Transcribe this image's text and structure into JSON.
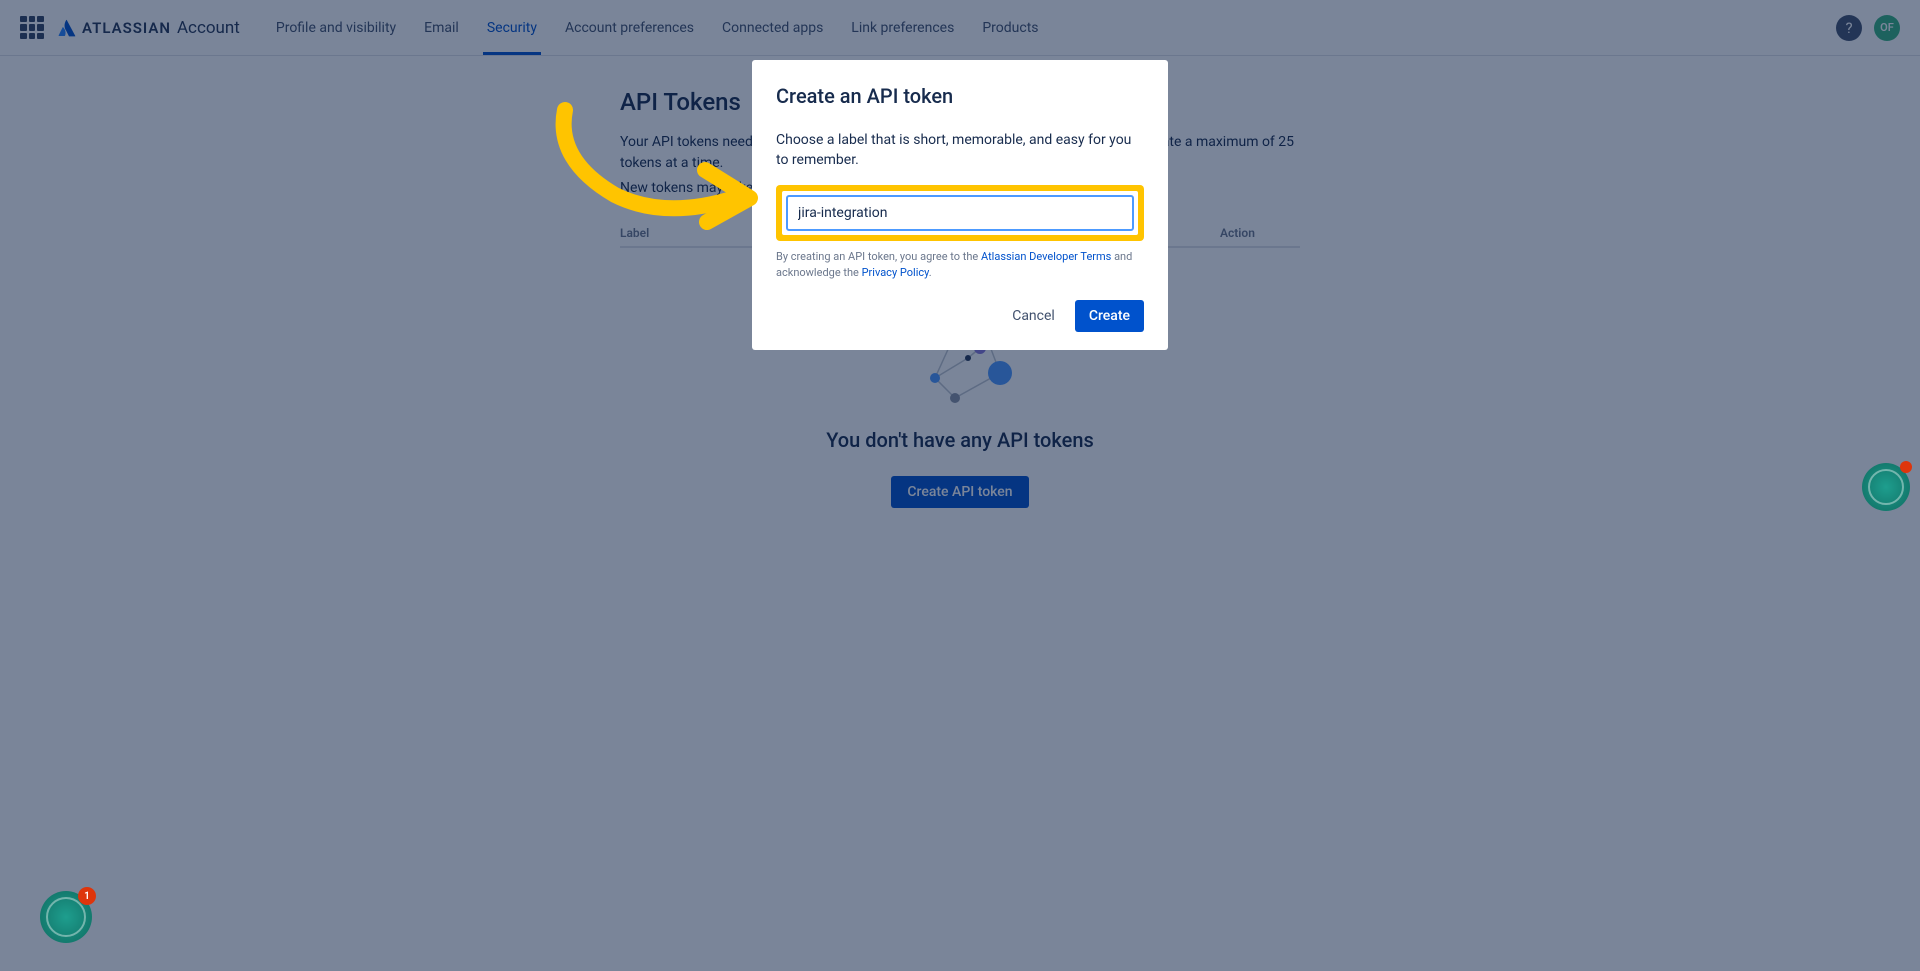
{
  "header": {
    "logo_main": "ATLASSIAN",
    "logo_sub": "Account",
    "nav": [
      {
        "label": "Profile and visibility",
        "active": false
      },
      {
        "label": "Email",
        "active": false
      },
      {
        "label": "Security",
        "active": true
      },
      {
        "label": "Account preferences",
        "active": false
      },
      {
        "label": "Connected apps",
        "active": false
      },
      {
        "label": "Link preferences",
        "active": false
      },
      {
        "label": "Products",
        "active": false
      }
    ],
    "help_label": "?",
    "avatar_initials": "OF"
  },
  "page": {
    "title": "API Tokens",
    "description": "Your API tokens need to be treated as securely as any other password. You can only create a maximum of 25 tokens at a time.",
    "note": "New tokens may take up to a minute to work after generation.",
    "table_headers": {
      "label": "Label",
      "action": "Action"
    },
    "empty_title": "You don't have any API tokens",
    "create_button": "Create API token"
  },
  "modal": {
    "title": "Create an API token",
    "description": "Choose a label that is short, memorable, and easy for you to remember.",
    "input_value": "jira-integration",
    "terms_prefix": "By creating an API token, you agree to the ",
    "terms_link1": "Atlassian Developer Terms",
    "terms_mid": " and acknowledge the ",
    "terms_link2": "Privacy Policy",
    "terms_suffix": ".",
    "cancel": "Cancel",
    "create": "Create"
  },
  "widgets": {
    "bottom_badge": "1"
  }
}
